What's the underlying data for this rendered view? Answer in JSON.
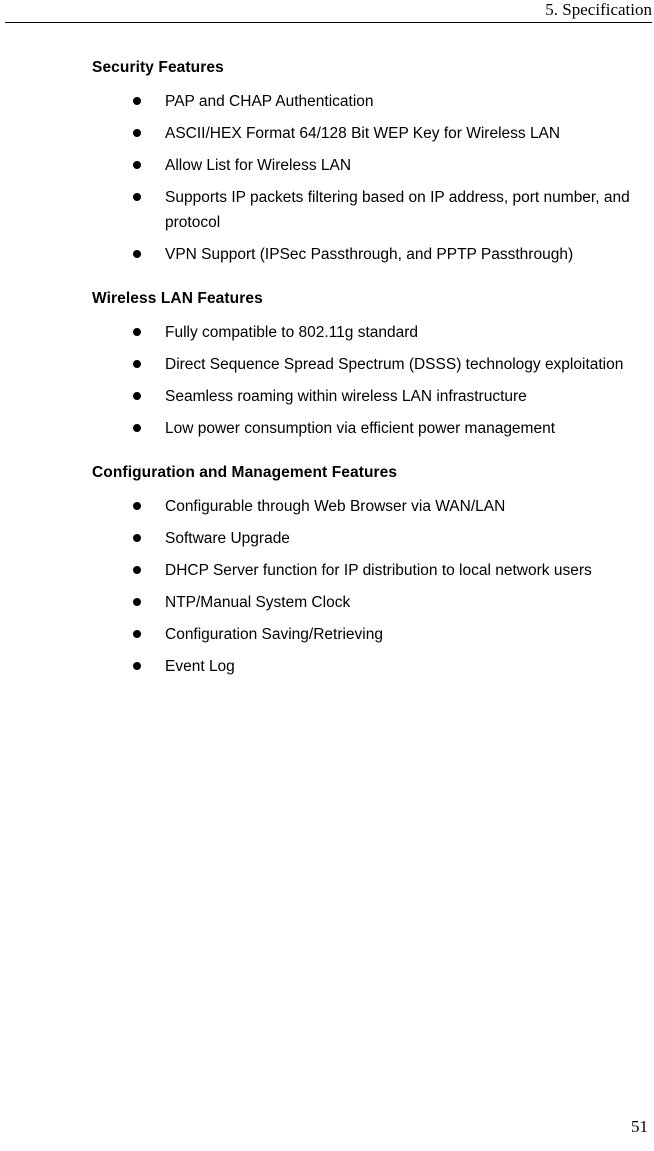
{
  "header": {
    "title": "5. Specification"
  },
  "footer": {
    "page_number": "51"
  },
  "sections": [
    {
      "heading": "Security Features",
      "bullets": [
        "PAP and CHAP Authentication",
        "ASCII/HEX Format 64/128 Bit WEP Key for Wireless LAN",
        "Allow List for Wireless LAN",
        "Supports IP packets filtering based on IP address, port number, and protocol",
        "VPN Support (IPSec Passthrough, and PPTP Passthrough)"
      ]
    },
    {
      "heading": "Wireless LAN Features",
      "bullets": [
        "Fully compatible to 802.11g standard",
        "Direct Sequence Spread Spectrum (DSSS) technology exploitation",
        "Seamless roaming within wireless LAN infrastructure",
        "Low power consumption via efficient power management"
      ]
    },
    {
      "heading": "Configuration and Management Features",
      "bullets": [
        "Configurable through Web Browser via WAN/LAN",
        "Software Upgrade",
        "DHCP Server function for IP distribution to local network users",
        "NTP/Manual System Clock",
        "Configuration Saving/Retrieving",
        "Event Log"
      ]
    }
  ]
}
